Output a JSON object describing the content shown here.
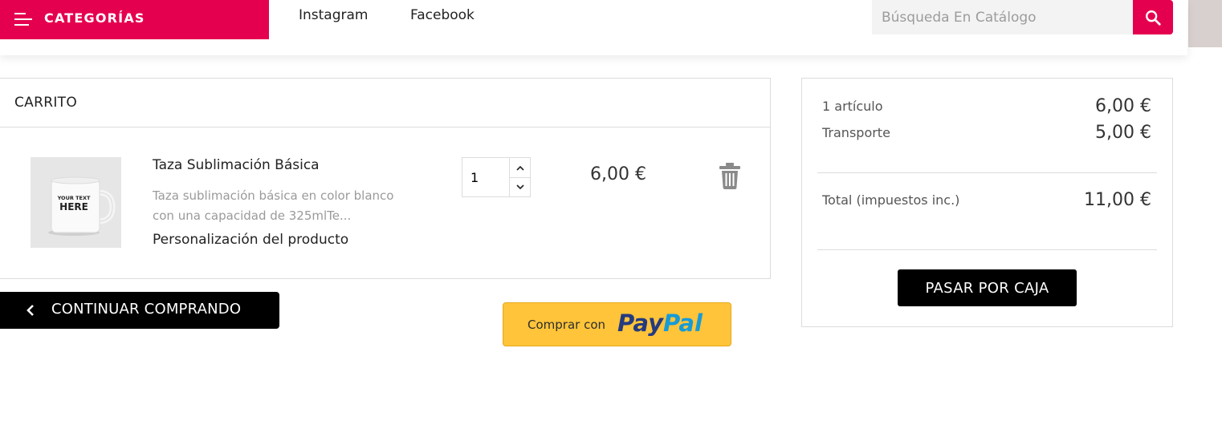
{
  "header": {
    "categories_label": "CATEGORÍAS",
    "nav_links": [
      "Instagram",
      "Facebook"
    ],
    "search_placeholder": "Búsqueda En Catálogo",
    "accent_color": "#e5004f"
  },
  "cart": {
    "title": "CARRITO",
    "item": {
      "thumb_text": [
        "YOUR TEXT",
        "HERE"
      ],
      "name": "Taza Sublimación Básica",
      "description_lines": [
        "Taza sublimación básica en color blanco",
        "con una capacidad de 325mlTe..."
      ],
      "customization": "Personalización del producto",
      "quantity": "1",
      "price": "6,00 €"
    },
    "continue_label": "CONTINUAR COMPRANDO",
    "paypal_pre": "Comprar con",
    "paypal_logo_a": "Pay",
    "paypal_logo_b": "Pal"
  },
  "summary": {
    "items_label": "1 artículo",
    "items_value": "6,00 €",
    "shipping_label": "Transporte",
    "shipping_value": "5,00 €",
    "total_label": "Total (impuestos inc.)",
    "total_value": "11,00 €",
    "checkout_label": "PASAR POR CAJA"
  }
}
